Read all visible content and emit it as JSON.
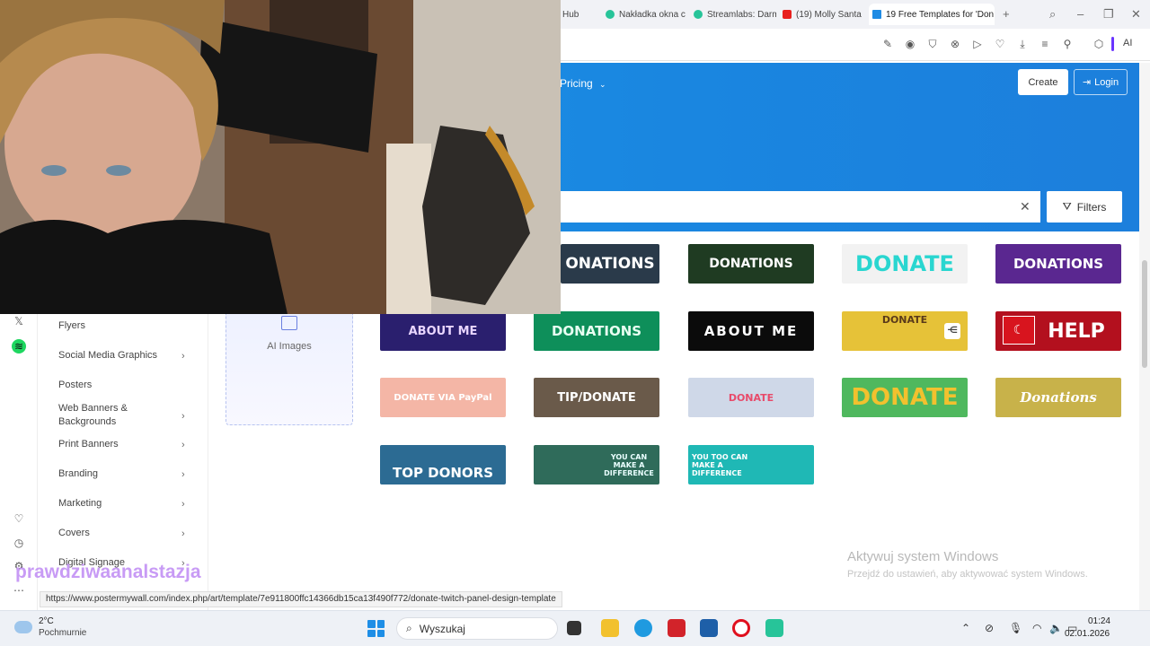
{
  "browser": {
    "tabs": [
      {
        "label": "Hub",
        "icon": "hub-favicon",
        "active": false
      },
      {
        "label": "Nakładka okna c",
        "icon": "streamlabs-favicon",
        "active": false
      },
      {
        "label": "Streamlabs: Darm",
        "icon": "streamlabs-favicon",
        "active": false
      },
      {
        "label": "(19) Molly Santa",
        "icon": "youtube-favicon",
        "active": false
      },
      {
        "label": "19 Free Templates for 'Don",
        "icon": "postermywall-favicon",
        "active": true
      }
    ],
    "new_tab": "+",
    "ai_label": "AI"
  },
  "site": {
    "nav_pricing": "Pricing",
    "create_label": "Create",
    "login_label": "Login",
    "search_value": "",
    "filters_label": "Filters"
  },
  "sidebar": {
    "items": [
      {
        "label": "Flyers",
        "has_children": false
      },
      {
        "label": "Social Media Graphics",
        "has_children": true
      },
      {
        "label": "Posters",
        "has_children": false
      },
      {
        "label": "Web Banners & Backgrounds",
        "has_children": true
      },
      {
        "label": "Print Banners",
        "has_children": true
      },
      {
        "label": "Branding",
        "has_children": true
      },
      {
        "label": "Marketing",
        "has_children": true
      },
      {
        "label": "Covers",
        "has_children": true
      },
      {
        "label": "Digital Signage",
        "has_children": true
      }
    ],
    "ai_card_label": "AI Images"
  },
  "templates": [
    {
      "text": "ONATIONS",
      "bg": "#2a3a4a",
      "fg": "#ffffff"
    },
    {
      "text": "DONATIONS",
      "bg": "#1f3b22",
      "fg": "#ffffff"
    },
    {
      "text": "DONATE",
      "bg": "#f2f2f2",
      "fg": "#29d6d0"
    },
    {
      "text": "DONATIONS",
      "bg": "#5a2790",
      "fg": "#ffffff"
    },
    {
      "text": "ABOUT ME",
      "bg": "#2a1f6e",
      "fg": "#e8d6ff"
    },
    {
      "text": "DONATIONS",
      "bg": "#0e8f5a",
      "fg": "#e8fff2"
    },
    {
      "text": "ABOUT ME",
      "bg": "#0b0b0b",
      "fg": "#ffffff"
    },
    {
      "text": "DONATE",
      "bg": "#e6c238",
      "fg": "#5a3a1a"
    },
    {
      "text": "HELP",
      "bg": "#b3101e",
      "fg": "#ffffff"
    },
    {
      "text": "DONATE VIA PayPal",
      "bg": "#f4b6a6",
      "fg": "#ffffff"
    },
    {
      "text": "TIP/DONATE",
      "bg": "#6a5a4a",
      "fg": "#ffffff"
    },
    {
      "text": "DONATE",
      "bg": "#cfd8e8",
      "fg": "#e84a6a"
    },
    {
      "text": "DONATE",
      "bg": "#4fb85e",
      "fg": "#f2c12e"
    },
    {
      "text": "Donations",
      "bg": "#c8b24a",
      "fg": "#ffffff"
    },
    {
      "text": "TOP DONORS",
      "bg": "#2c6b93",
      "fg": "#ffffff"
    },
    {
      "text": "YOU CAN MAKE A DIFFERENCE",
      "bg": "#2f6b5a",
      "fg": "#eaffff"
    },
    {
      "text": "YOU TOO CAN MAKE A DIFFERENCE",
      "bg": "#1fb8b5",
      "fg": "#ffffff"
    }
  ],
  "overlay": {
    "activate_title": "Aktywuj system Windows",
    "activate_sub": "Przejdź do ustawień, aby aktywować system Windows.",
    "streamer_name": "prawdziwaanalstazja",
    "status_url": "https://www.postermywall.com/index.php/art/template/7e911800ffc14366db15ca13f490f772/donate-twitch-panel-design-template"
  },
  "taskbar": {
    "weather_temp": "2°C",
    "weather_desc": "Pochmurnie",
    "search_label": "Wyszukaj",
    "time": "01:24",
    "date": "02.01.2026"
  }
}
